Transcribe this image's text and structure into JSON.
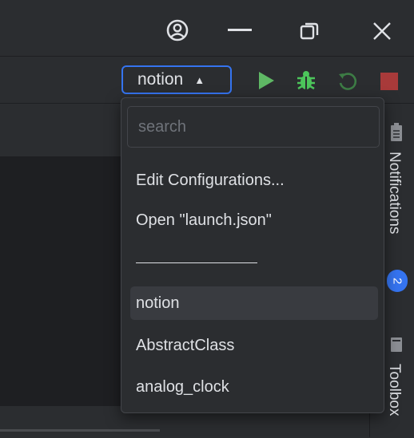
{
  "window": {
    "controls": [
      {
        "name": "account-icon"
      },
      {
        "name": "minimize-icon"
      },
      {
        "name": "restore-icon"
      },
      {
        "name": "close-icon"
      }
    ]
  },
  "toolbar": {
    "config_label": "notion",
    "icons": [
      "run-icon",
      "debug-icon",
      "rerun-icon",
      "stop-icon"
    ],
    "colors": {
      "run": "#5fb865",
      "debug": "#4cc55b",
      "rerun": "#3d7c45",
      "stop": "#a83a3a",
      "accent": "#3574f0"
    }
  },
  "popup": {
    "search_placeholder": "search",
    "actions": [
      "Edit Configurations...",
      "Open \"launch.json\""
    ],
    "separator": "—————————",
    "configs": [
      "notion",
      "AbstractClass",
      "analog_clock"
    ],
    "selected": "notion"
  },
  "right_panel": {
    "notifications_label": "Notifications",
    "notifications_count": "2",
    "toolbox_label": "Toolbox"
  }
}
